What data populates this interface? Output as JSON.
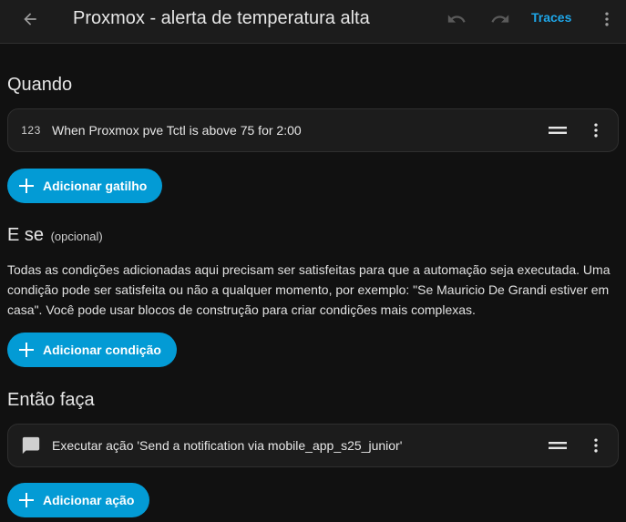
{
  "header": {
    "title": "Proxmox - alerta de temperatura alta",
    "traces_label": "Traces",
    "back_icon": "arrow-left-icon",
    "undo_icon": "undo-icon",
    "redo_icon": "redo-icon",
    "menu_icon": "dots-vertical-icon"
  },
  "triggers": {
    "heading": "Quando",
    "items": [
      {
        "icon_text": "123",
        "label": "When Proxmox pve Tctl is above 75 for 2:00"
      }
    ],
    "add_label": "Adicionar gatilho"
  },
  "conditions": {
    "heading": "E se",
    "optional_label": "(opcional)",
    "description": "Todas as condições adicionadas aqui precisam ser satisfeitas para que a automação seja executada. Uma condição pode ser satisfeita ou não a qualquer momento, por exemplo: \"Se Mauricio De Grandi estiver em casa\". Você pode usar blocos de construção para criar condições mais complexas.",
    "add_label": "Adicionar condição"
  },
  "actions": {
    "heading": "Então faça",
    "items": [
      {
        "icon": "message-icon",
        "label": "Executar ação 'Send a notification via mobile_app_s25_junior'"
      }
    ],
    "add_label": "Adicionar ação"
  },
  "colors": {
    "accent": "#039bd5",
    "traces": "#1ea6e8",
    "background": "#111111",
    "card": "#1c1c1c"
  }
}
